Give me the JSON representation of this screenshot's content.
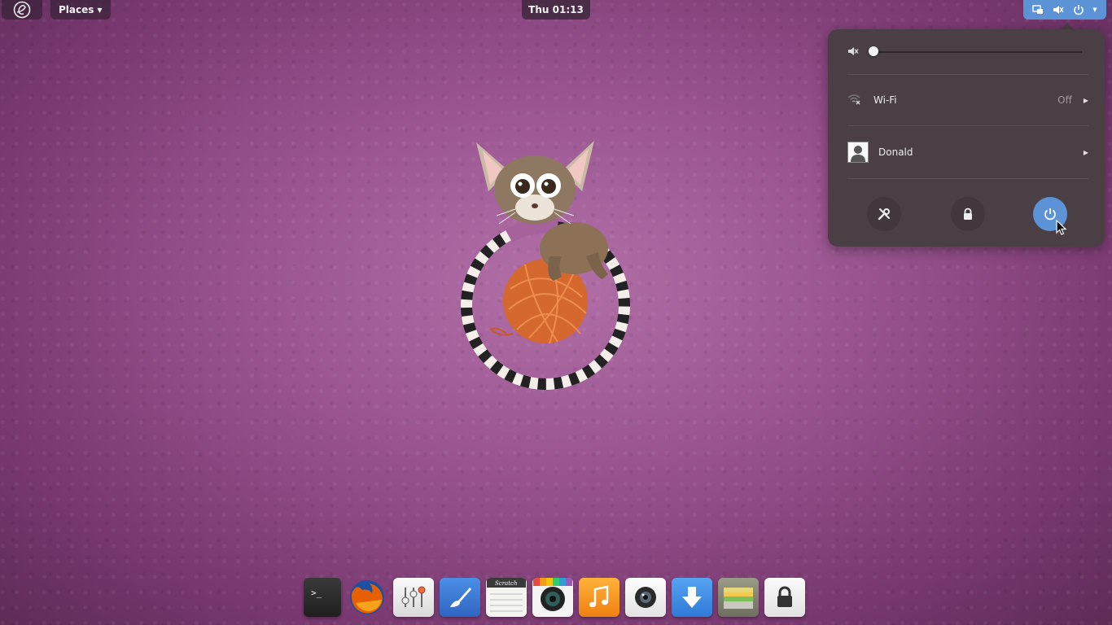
{
  "topbar": {
    "applications_icon": "elementary-logo-icon",
    "places_label": "Places",
    "clock_text": "Thu 01:13",
    "tray_icons": [
      "display-icon",
      "volume-muted-icon",
      "power-icon",
      "chevron-down-icon"
    ]
  },
  "system_menu": {
    "volume": {
      "icon": "volume-muted-icon",
      "level": 0
    },
    "wifi": {
      "icon": "wifi-off-icon",
      "label": "Wi-Fi",
      "status": "Off"
    },
    "user": {
      "icon": "avatar",
      "name": "Donald"
    },
    "actions": [
      {
        "name": "settings-button",
        "icon": "tools-icon"
      },
      {
        "name": "lock-button",
        "icon": "lock-icon"
      },
      {
        "name": "power-button",
        "icon": "power-icon",
        "active": true
      }
    ]
  },
  "dock": {
    "items": [
      {
        "name": "terminal-icon",
        "color": "#2b2b2b"
      },
      {
        "name": "firefox-icon",
        "color": "#e66000"
      },
      {
        "name": "switchboard-icon",
        "color": "#ededed"
      },
      {
        "name": "midori-icon",
        "color": "#3a7bd5"
      },
      {
        "name": "scratch-icon",
        "color": "#f5f5f0"
      },
      {
        "name": "shotwell-icon",
        "color": "#f0f0f0"
      },
      {
        "name": "noise-icon",
        "color": "#f39c12"
      },
      {
        "name": "snap-icon",
        "color": "#f2f2f2"
      },
      {
        "name": "software-center-icon",
        "color": "#3d8ee6"
      },
      {
        "name": "files-icon",
        "color": "#8a8a7a"
      },
      {
        "name": "lock-screen-icon",
        "color": "#f0f0f0"
      }
    ]
  },
  "colors": {
    "accent": "#5b93d6",
    "menu_bg": "#4a3f44",
    "wallpaper": "#9a5590"
  }
}
